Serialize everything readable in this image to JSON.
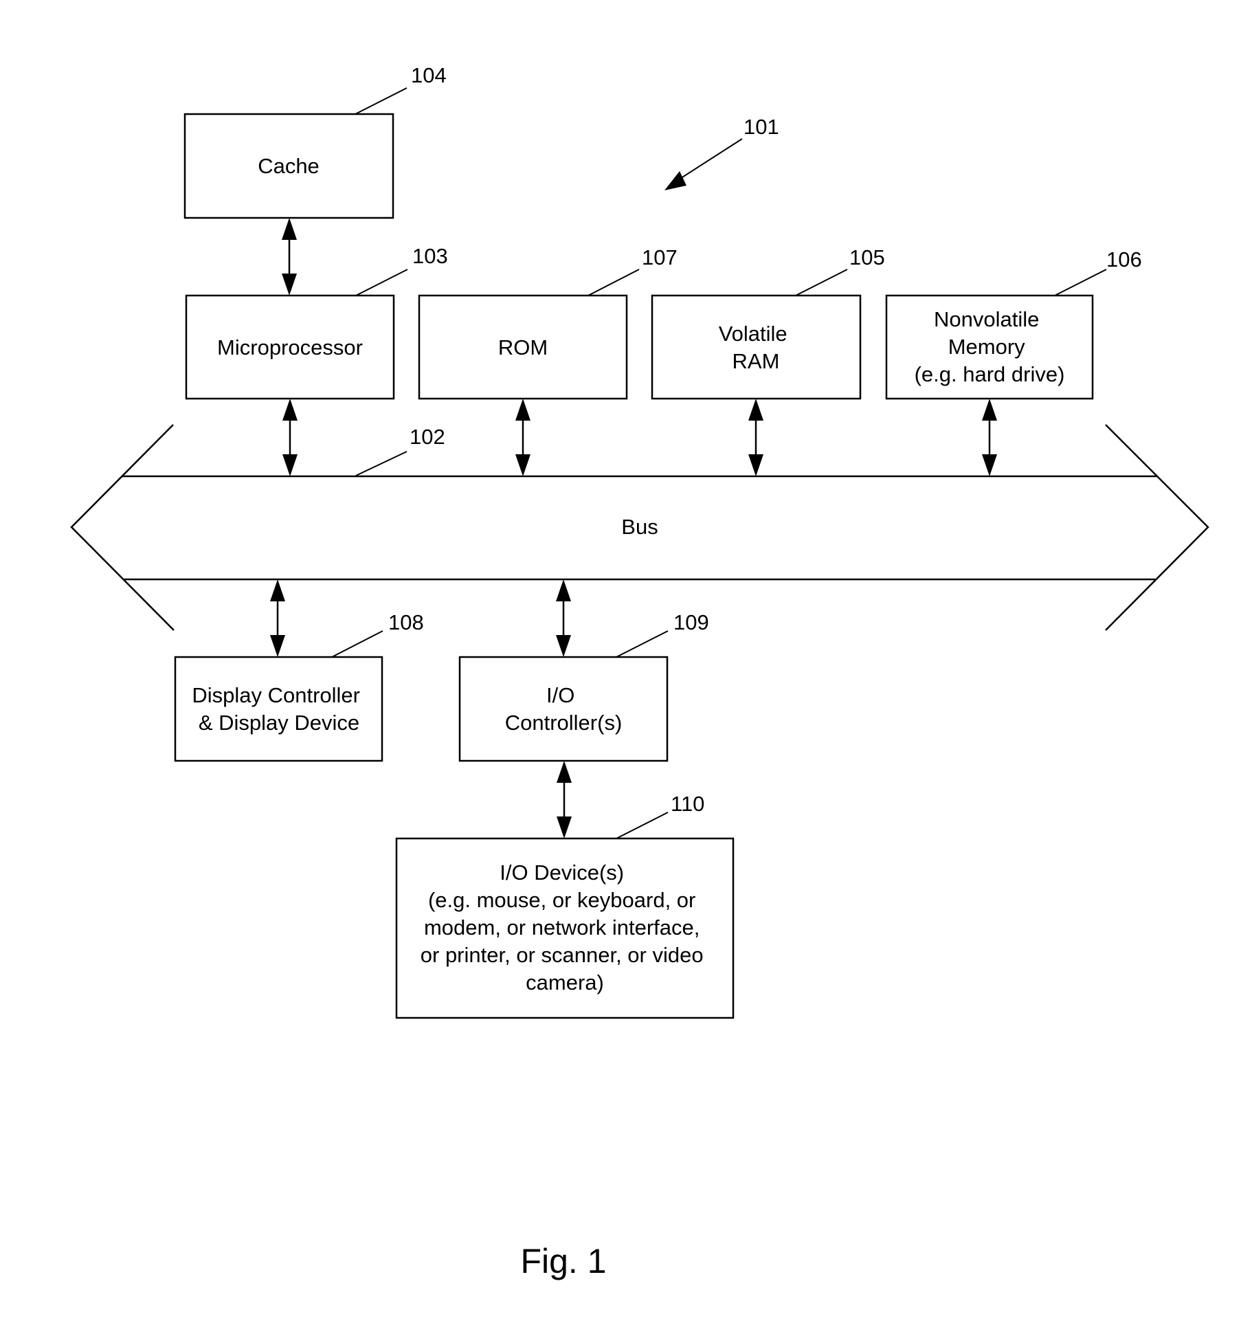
{
  "figure": {
    "caption": "Fig. 1",
    "system_ref": "101"
  },
  "bus": {
    "label": "Bus",
    "ref": "102"
  },
  "components": {
    "cache": {
      "ref": "104",
      "lines": [
        "Cache"
      ]
    },
    "microprocessor": {
      "ref": "103",
      "lines": [
        "Microprocessor"
      ]
    },
    "rom": {
      "ref": "107",
      "lines": [
        "ROM"
      ]
    },
    "volatile_ram": {
      "ref": "105",
      "lines": [
        "Volatile",
        "RAM"
      ]
    },
    "nonvolatile_memory": {
      "ref": "106",
      "lines": [
        "Nonvolatile",
        "Memory",
        "(e.g. hard drive)"
      ]
    },
    "display": {
      "ref": "108",
      "lines": [
        "Display Controller",
        "& Display Device"
      ]
    },
    "io_controller": {
      "ref": "109",
      "lines": [
        "I/O",
        "Controller(s)"
      ]
    },
    "io_devices": {
      "ref": "110",
      "lines": [
        "I/O Device(s)",
        "(e.g. mouse, or keyboard, or",
        "modem, or network interface,",
        "or printer, or scanner, or video",
        "camera)"
      ]
    }
  },
  "connections": [
    {
      "from": "cache",
      "to": "microprocessor",
      "type": "bidirectional"
    },
    {
      "from": "microprocessor",
      "to": "bus",
      "type": "bidirectional"
    },
    {
      "from": "rom",
      "to": "bus",
      "type": "bidirectional"
    },
    {
      "from": "volatile_ram",
      "to": "bus",
      "type": "bidirectional"
    },
    {
      "from": "nonvolatile_memory",
      "to": "bus",
      "type": "bidirectional"
    },
    {
      "from": "bus",
      "to": "display",
      "type": "bidirectional"
    },
    {
      "from": "bus",
      "to": "io_controller",
      "type": "bidirectional"
    },
    {
      "from": "io_controller",
      "to": "io_devices",
      "type": "bidirectional"
    }
  ]
}
